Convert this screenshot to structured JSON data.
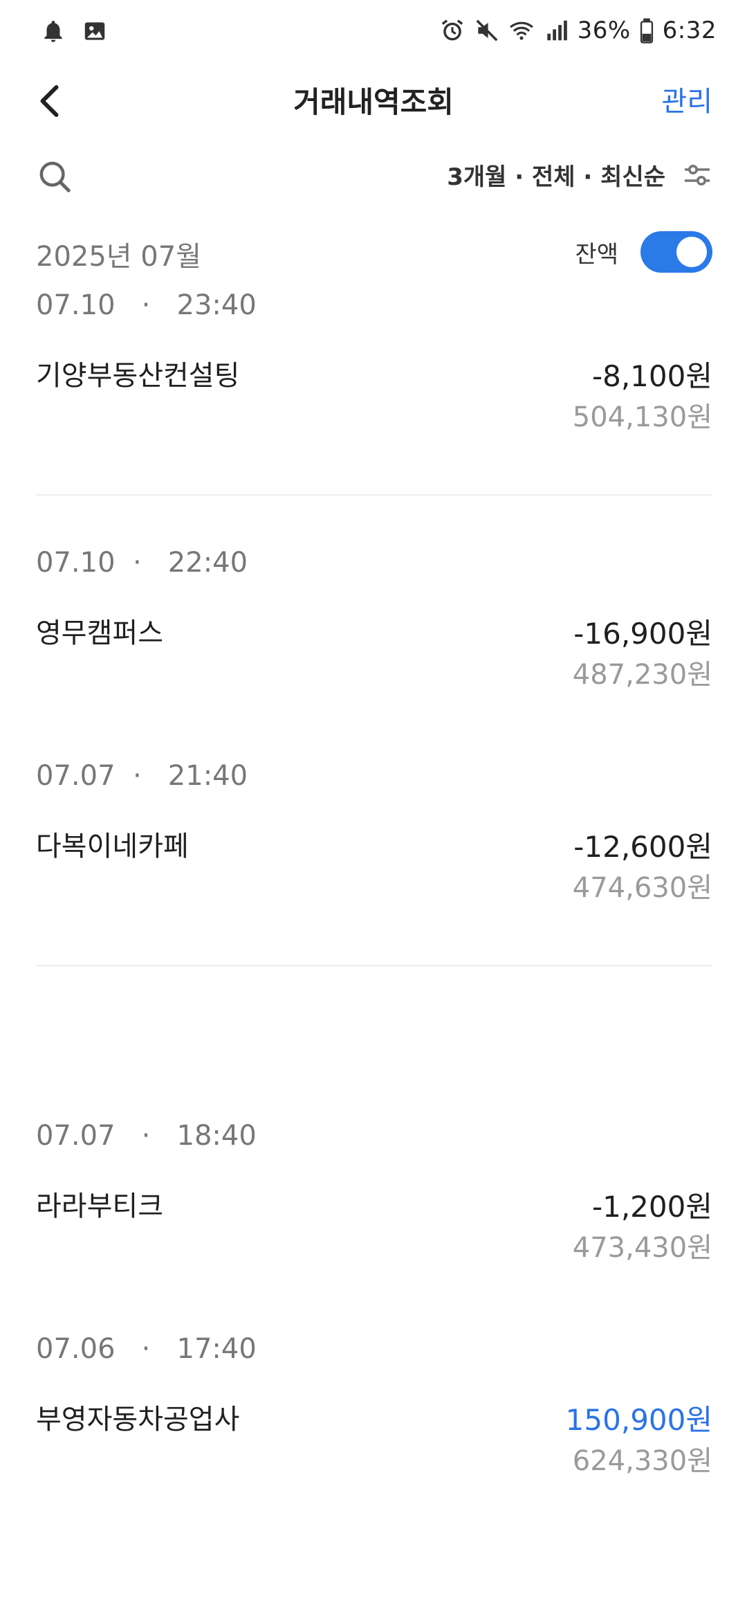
{
  "status_bar": {
    "icons_left": [
      "notification-bell-icon",
      "gallery-image-icon"
    ],
    "icons_right": [
      "alarm-icon",
      "mute-icon",
      "wifi-icon",
      "signal-icon",
      "battery-icon"
    ],
    "battery": "36%",
    "time": "6:32"
  },
  "header": {
    "title": "거래내역조회",
    "manage_label": "관리"
  },
  "filter": {
    "summary": "3개월 · 전체 · 최신순"
  },
  "month": {
    "label": "2025년 07월"
  },
  "balance_toggle": {
    "label": "잔액",
    "on": true
  },
  "transactions": [
    {
      "date": "07.10   ·   23:40",
      "name": "기양부동산컨설팅",
      "amount": "-8,100원",
      "balance": "504,130원"
    },
    {
      "date": "07.10  ·   22:40",
      "name": "영무캠퍼스",
      "amount": "-16,900원",
      "balance": "487,230원"
    },
    {
      "date": "07.07  ·   21:40",
      "name": "다복이네카페",
      "amount": "-12,600원",
      "balance": "474,630원"
    },
    {
      "date": "07.07   ·   18:40",
      "name": "라라부티크",
      "amount": "-1,200원",
      "balance": "473,430원"
    },
    {
      "date": "07.06   ·   17:40",
      "name": "부영자동차공업사",
      "amount": "150,900원",
      "balance": "624,330원"
    }
  ],
  "colors": {
    "accent": "#2a73e8",
    "income": "#2a73e8",
    "muted": "#9a9a9a"
  }
}
